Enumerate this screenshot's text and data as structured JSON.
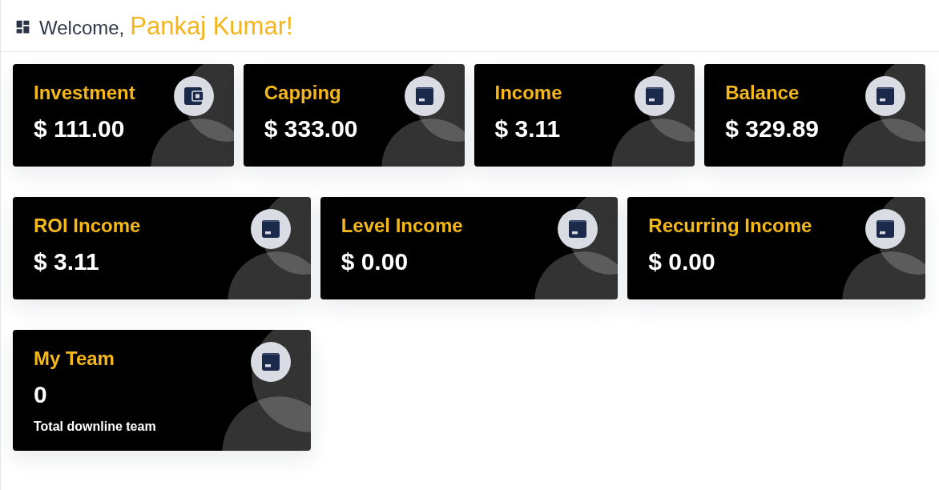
{
  "header": {
    "greeting": "Welcome,",
    "name": "Pankaj Kumar!"
  },
  "rows": [
    {
      "cards": [
        {
          "kind": "wallet",
          "title": "Investment",
          "value": "$ 111.00"
        },
        {
          "kind": "panel",
          "title": "Capping",
          "value": "$ 333.00"
        },
        {
          "kind": "panel",
          "title": "Income",
          "value": "$ 3.11"
        },
        {
          "kind": "panel",
          "title": "Balance",
          "value": "$ 329.89"
        }
      ]
    },
    {
      "cards": [
        {
          "kind": "panel",
          "title": "ROI Income",
          "value": "$ 3.11"
        },
        {
          "kind": "panel",
          "title": "Level Income",
          "value": "$ 0.00"
        },
        {
          "kind": "panel",
          "title": "Recurring Income",
          "value": "$ 0.00"
        }
      ]
    },
    {
      "cards": [
        {
          "kind": "panel",
          "title": "My Team",
          "value": "0",
          "note": "Total downline team"
        }
      ]
    }
  ]
}
